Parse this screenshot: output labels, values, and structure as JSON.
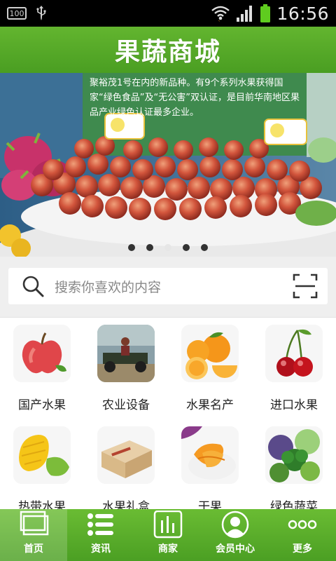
{
  "status_bar": {
    "battery_badge": "100",
    "time": "16:56"
  },
  "header": {
    "title": "果蔬商城"
  },
  "banner": {
    "sign_text": "聚裕茂1号在内的新品种。有9个系列水果获得国家“绿色食品”及“无公害”双认证，是目前华南地区果品产业绿色认证最多企业。",
    "slide_count": 5,
    "active_slide": 3
  },
  "search": {
    "placeholder": "搜索你喜欢的内容"
  },
  "categories": [
    {
      "label": "国产水果",
      "icon": "apple-icon"
    },
    {
      "label": "农业设备",
      "icon": "tractor-icon"
    },
    {
      "label": "水果名产",
      "icon": "orange-icon"
    },
    {
      "label": "进口水果",
      "icon": "cherry-icon"
    },
    {
      "label": "热带水果",
      "icon": "mango-icon"
    },
    {
      "label": "水果礼盒",
      "icon": "gift-box-icon"
    },
    {
      "label": "干果",
      "icon": "dried-fruit-icon"
    },
    {
      "label": "绿色蔬菜",
      "icon": "vegetable-icon"
    }
  ],
  "tabs": [
    {
      "label": "首页",
      "icon": "home-icon",
      "active": true
    },
    {
      "label": "资讯",
      "icon": "list-icon",
      "active": false
    },
    {
      "label": "商家",
      "icon": "chart-icon",
      "active": false
    },
    {
      "label": "会员中心",
      "icon": "user-icon",
      "active": false
    },
    {
      "label": "更多",
      "icon": "more-icon",
      "active": false
    }
  ],
  "colors": {
    "brand_green": "#4fa326"
  }
}
